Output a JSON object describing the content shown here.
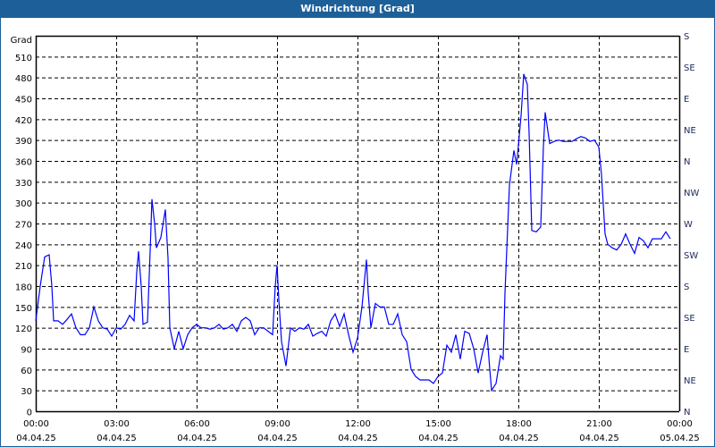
{
  "title": "Windrichtung [Grad]",
  "chart_data": {
    "type": "line",
    "title": "Windrichtung [Grad]",
    "ylabel": "Grad",
    "ylim": [
      0,
      540
    ],
    "yticks": [
      0,
      30,
      60,
      90,
      120,
      150,
      180,
      210,
      240,
      270,
      300,
      330,
      360,
      390,
      420,
      450,
      480,
      510
    ],
    "right_axis": {
      "values": [
        0,
        45,
        90,
        135,
        180,
        225,
        270,
        315,
        360,
        405,
        450,
        495,
        540
      ],
      "labels": [
        "N",
        "NE",
        "E",
        "SE",
        "S",
        "SW",
        "W",
        "NW",
        "N",
        "NE",
        "E",
        "SE",
        "S"
      ]
    },
    "xlim_minutes": [
      0,
      1440
    ],
    "xticks": [
      {
        "minute": 0,
        "time": "00:00",
        "date": "04.04.25"
      },
      {
        "minute": 180,
        "time": "03:00",
        "date": "04.04.25"
      },
      {
        "minute": 360,
        "time": "06:00",
        "date": "04.04.25"
      },
      {
        "minute": 540,
        "time": "09:00",
        "date": "04.04.25"
      },
      {
        "minute": 720,
        "time": "12:00",
        "date": "04.04.25"
      },
      {
        "minute": 900,
        "time": "15:00",
        "date": "04.04.25"
      },
      {
        "minute": 1080,
        "time": "18:00",
        "date": "04.04.25"
      },
      {
        "minute": 1260,
        "time": "21:00",
        "date": "04.04.25"
      },
      {
        "minute": 1440,
        "time": "00:00",
        "date": "05.04.25"
      }
    ],
    "grid": true,
    "line_color": "#0000ff",
    "series": [
      {
        "name": "Windrichtung",
        "points": [
          [
            0,
            130
          ],
          [
            10,
            180
          ],
          [
            20,
            222
          ],
          [
            30,
            225
          ],
          [
            36,
            180
          ],
          [
            40,
            130
          ],
          [
            50,
            130
          ],
          [
            60,
            125
          ],
          [
            70,
            132
          ],
          [
            80,
            140
          ],
          [
            90,
            120
          ],
          [
            100,
            110
          ],
          [
            110,
            110
          ],
          [
            120,
            120
          ],
          [
            130,
            150
          ],
          [
            140,
            130
          ],
          [
            150,
            120
          ],
          [
            160,
            118
          ],
          [
            170,
            108
          ],
          [
            180,
            120
          ],
          [
            190,
            118
          ],
          [
            200,
            125
          ],
          [
            210,
            138
          ],
          [
            220,
            130
          ],
          [
            226,
            200
          ],
          [
            230,
            230
          ],
          [
            236,
            180
          ],
          [
            240,
            125
          ],
          [
            250,
            128
          ],
          [
            256,
            230
          ],
          [
            260,
            305
          ],
          [
            266,
            270
          ],
          [
            270,
            235
          ],
          [
            280,
            250
          ],
          [
            290,
            290
          ],
          [
            296,
            220
          ],
          [
            300,
            120
          ],
          [
            310,
            90
          ],
          [
            320,
            115
          ],
          [
            330,
            90
          ],
          [
            340,
            110
          ],
          [
            350,
            120
          ],
          [
            360,
            125
          ],
          [
            370,
            120
          ],
          [
            380,
            120
          ],
          [
            390,
            118
          ],
          [
            400,
            120
          ],
          [
            410,
            125
          ],
          [
            420,
            118
          ],
          [
            430,
            120
          ],
          [
            440,
            125
          ],
          [
            450,
            115
          ],
          [
            460,
            130
          ],
          [
            470,
            135
          ],
          [
            480,
            130
          ],
          [
            490,
            110
          ],
          [
            500,
            120
          ],
          [
            510,
            120
          ],
          [
            520,
            115
          ],
          [
            530,
            110
          ],
          [
            536,
            180
          ],
          [
            540,
            210
          ],
          [
            544,
            160
          ],
          [
            550,
            100
          ],
          [
            560,
            65
          ],
          [
            570,
            120
          ],
          [
            580,
            115
          ],
          [
            590,
            120
          ],
          [
            600,
            118
          ],
          [
            610,
            125
          ],
          [
            620,
            108
          ],
          [
            630,
            112
          ],
          [
            640,
            115
          ],
          [
            650,
            108
          ],
          [
            660,
            130
          ],
          [
            670,
            140
          ],
          [
            680,
            122
          ],
          [
            690,
            140
          ],
          [
            700,
            110
          ],
          [
            710,
            85
          ],
          [
            720,
            105
          ],
          [
            730,
            150
          ],
          [
            740,
            218
          ],
          [
            744,
            170
          ],
          [
            750,
            120
          ],
          [
            760,
            155
          ],
          [
            770,
            150
          ],
          [
            780,
            150
          ],
          [
            790,
            125
          ],
          [
            800,
            125
          ],
          [
            810,
            140
          ],
          [
            820,
            110
          ],
          [
            830,
            100
          ],
          [
            840,
            60
          ],
          [
            850,
            50
          ],
          [
            860,
            45
          ],
          [
            870,
            45
          ],
          [
            880,
            45
          ],
          [
            890,
            40
          ],
          [
            900,
            50
          ],
          [
            910,
            55
          ],
          [
            920,
            95
          ],
          [
            930,
            85
          ],
          [
            940,
            110
          ],
          [
            950,
            75
          ],
          [
            960,
            115
          ],
          [
            970,
            112
          ],
          [
            980,
            90
          ],
          [
            990,
            55
          ],
          [
            1000,
            85
          ],
          [
            1010,
            110
          ],
          [
            1016,
            60
          ],
          [
            1020,
            30
          ],
          [
            1030,
            40
          ],
          [
            1040,
            80
          ],
          [
            1046,
            75
          ],
          [
            1050,
            170
          ],
          [
            1060,
            325
          ],
          [
            1070,
            375
          ],
          [
            1076,
            355
          ],
          [
            1080,
            382
          ],
          [
            1086,
            425
          ],
          [
            1092,
            485
          ],
          [
            1100,
            470
          ],
          [
            1104,
            400
          ],
          [
            1110,
            260
          ],
          [
            1120,
            258
          ],
          [
            1130,
            265
          ],
          [
            1136,
            380
          ],
          [
            1140,
            430
          ],
          [
            1150,
            385
          ],
          [
            1160,
            388
          ],
          [
            1170,
            390
          ],
          [
            1180,
            388
          ],
          [
            1190,
            388
          ],
          [
            1200,
            388
          ],
          [
            1210,
            392
          ],
          [
            1220,
            395
          ],
          [
            1230,
            393
          ],
          [
            1240,
            388
          ],
          [
            1250,
            390
          ],
          [
            1260,
            380
          ],
          [
            1266,
            340
          ],
          [
            1274,
            255
          ],
          [
            1280,
            240
          ],
          [
            1290,
            235
          ],
          [
            1300,
            232
          ],
          [
            1310,
            240
          ],
          [
            1320,
            255
          ],
          [
            1330,
            240
          ],
          [
            1340,
            227
          ],
          [
            1350,
            250
          ],
          [
            1360,
            245
          ],
          [
            1370,
            235
          ],
          [
            1380,
            248
          ],
          [
            1390,
            248
          ],
          [
            1400,
            248
          ],
          [
            1410,
            258
          ],
          [
            1420,
            248
          ]
        ]
      }
    ]
  }
}
